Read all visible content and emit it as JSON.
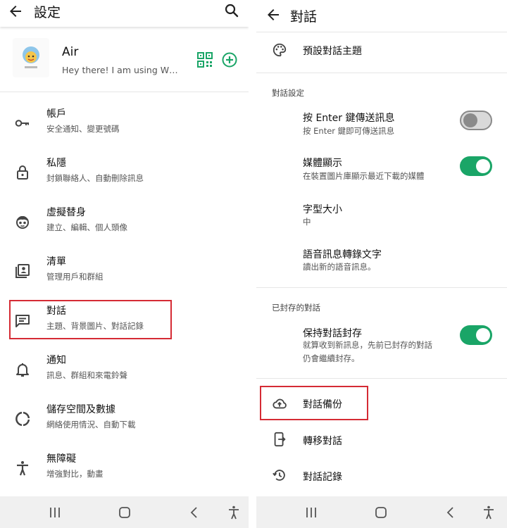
{
  "colors": {
    "accent": "#1aa567",
    "highlight": "#d52b34",
    "navbar": "#f0f0f0"
  },
  "left": {
    "title": "設定",
    "profile": {
      "name": "Air",
      "status": "Hey there! I am using WhatsApp."
    },
    "items": [
      {
        "icon": "key-icon",
        "title": "帳戶",
        "subtitle": "安全通知、變更號碼"
      },
      {
        "icon": "lock-icon",
        "title": "私隱",
        "subtitle": "封鎖聯絡人、自動刪除訊息"
      },
      {
        "icon": "avatar-face-icon",
        "title": "虛擬替身",
        "subtitle": "建立、編輯、個人頭像"
      },
      {
        "icon": "contact-list-icon",
        "title": "清單",
        "subtitle": "管理用戶和群組"
      },
      {
        "icon": "chat-icon",
        "title": "對話",
        "subtitle": "主題、背景圖片、對話記錄"
      },
      {
        "icon": "bell-icon",
        "title": "通知",
        "subtitle": "訊息、群組和來電鈴聲"
      },
      {
        "icon": "storage-icon",
        "title": "儲存空間及數據",
        "subtitle": "網絡使用情況、自動下載"
      },
      {
        "icon": "accessibility-icon",
        "title": "無障礙",
        "subtitle": "增強對比，動畫"
      }
    ]
  },
  "right": {
    "title": "對話",
    "theme_label": "預設對話主題",
    "section_settings": "對話設定",
    "settings": [
      {
        "title": "按 Enter 鍵傳送訊息",
        "subtitle": "按 Enter 鍵即可傳送訊息",
        "toggle": false
      },
      {
        "title": "媒體顯示",
        "subtitle": "在裝置圖片庫顯示最近下載的媒體",
        "toggle": true
      },
      {
        "title": "字型大小",
        "subtitle": "中"
      },
      {
        "title": "語音訊息轉錄文字",
        "subtitle": "讀出新的語音訊息。"
      }
    ],
    "section_archived": "已封存的對話",
    "archive": {
      "title": "保持對話封存",
      "subtitle": "就算收到新訊息，先前已封存的對話仍會繼續封存。",
      "toggle": true
    },
    "actions": [
      {
        "icon": "cloud-upload-icon",
        "label": "對話備份"
      },
      {
        "icon": "phone-transfer-icon",
        "label": "轉移對話"
      },
      {
        "icon": "history-icon",
        "label": "對話記錄"
      }
    ]
  }
}
